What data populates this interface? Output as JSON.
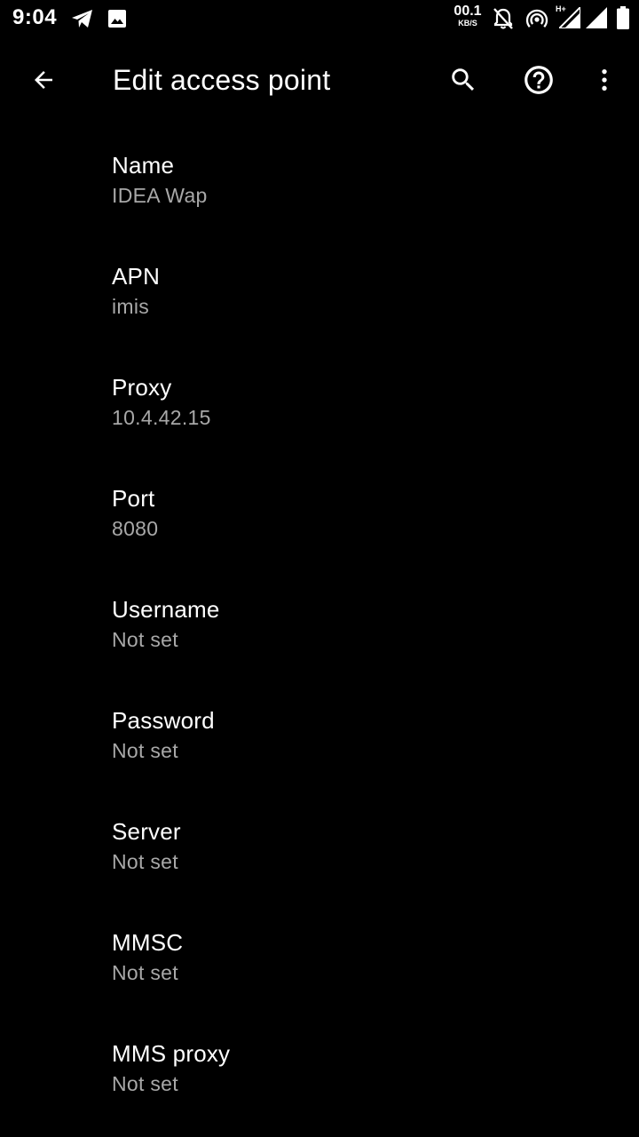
{
  "status_bar": {
    "time": "9:04",
    "net_speed_value": "00.1",
    "net_speed_unit": "KB/S",
    "network_type": "H+",
    "icons": [
      "telegram-icon",
      "gallery-icon",
      "bell-off-icon",
      "hotspot-icon",
      "signal-icon",
      "signal-icon",
      "battery-icon"
    ]
  },
  "app_bar": {
    "title": "Edit access point",
    "back_icon": "arrow-back-icon",
    "search_icon": "search-icon",
    "help_icon": "help-icon",
    "more_icon": "more-vert-icon"
  },
  "preferences": [
    {
      "title": "Name",
      "summary": "IDEA Wap"
    },
    {
      "title": "APN",
      "summary": "imis"
    },
    {
      "title": "Proxy",
      "summary": "10.4.42.15"
    },
    {
      "title": "Port",
      "summary": "8080"
    },
    {
      "title": "Username",
      "summary": "Not set"
    },
    {
      "title": "Password",
      "summary": "Not set"
    },
    {
      "title": "Server",
      "summary": "Not set"
    },
    {
      "title": "MMSC",
      "summary": "Not set"
    },
    {
      "title": "MMS proxy",
      "summary": "Not set"
    }
  ],
  "colors": {
    "background": "#000000",
    "title_text": "#ffffff",
    "summary_text": "#a8a8a8"
  }
}
